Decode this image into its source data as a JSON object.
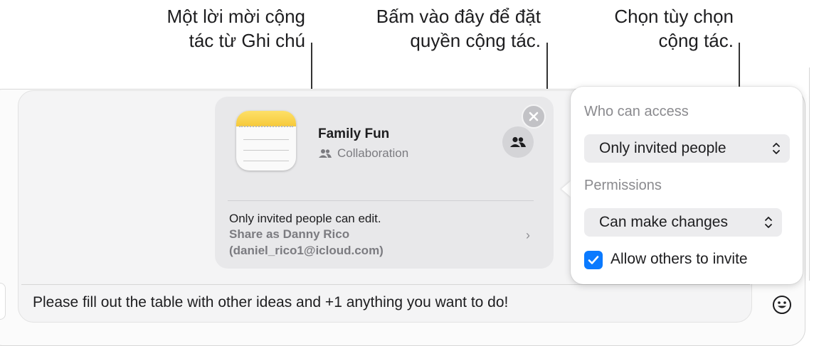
{
  "callouts": {
    "left": {
      "line1": "Một lời mời cộng",
      "line2": "tác từ Ghi chú"
    },
    "middle": {
      "line1": "Bấm vào đây để đặt",
      "line2": "quyền cộng tác."
    },
    "right": {
      "line1": "Chọn tùy chọn",
      "line2": "cộng tác."
    }
  },
  "card": {
    "app_icon": "notes-icon",
    "title": "Family Fun",
    "subtitle": "Collaboration",
    "subtitle_icon": "people-icon",
    "collab_button_icon": "people-icon",
    "close_icon": "close-icon",
    "permission_summary": "Only invited people can edit.",
    "share_as": "Share as Danny Rico",
    "email": "(daniel_rico1@icloud.com)",
    "chevron": "›"
  },
  "popover": {
    "access_label": "Who can access",
    "access_value": "Only invited people",
    "permissions_label": "Permissions",
    "permissions_value": "Can make changes",
    "allow_invite_label": "Allow others to invite",
    "allow_invite_checked": true
  },
  "compose": {
    "text": "Please fill out the table with other ideas and +1 anything you want to do!",
    "emoji_icon": "smiley-icon"
  },
  "colors": {
    "accent": "#0a7aff",
    "card_bg": "#e8e8ea",
    "notes_yellow": "#f6c93a"
  }
}
